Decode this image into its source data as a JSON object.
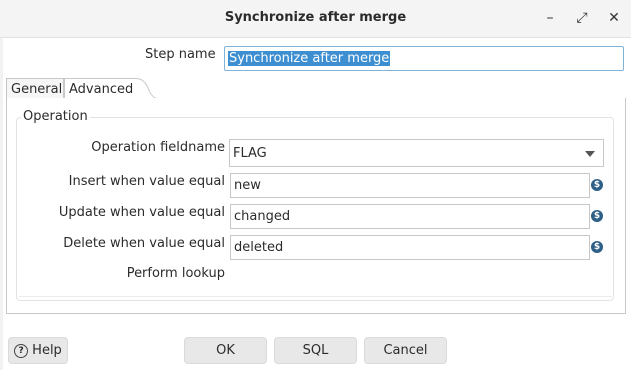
{
  "window": {
    "title": "Synchronize after merge",
    "minimize_glyph": "–",
    "maximize_glyph": "⤢",
    "close_glyph": "✕"
  },
  "step": {
    "label": "Step name",
    "value": "Synchronize after merge"
  },
  "tabs": [
    {
      "label": "General",
      "active": false
    },
    {
      "label": "Advanced",
      "active": true
    }
  ],
  "operation": {
    "group_title": "Operation",
    "fieldname_label": "Operation fieldname",
    "fieldname_value": "FLAG",
    "insert_label": "Insert when value equal",
    "insert_value": "new",
    "update_label": "Update when value equal",
    "update_value": "changed",
    "delete_label": "Delete when value equal",
    "delete_value": "deleted",
    "perform_lookup_label": "Perform lookup",
    "variable_icon_glyph": "$"
  },
  "buttons": {
    "help": "Help",
    "ok": "OK",
    "sql": "SQL",
    "cancel": "Cancel"
  },
  "colors": {
    "accent": "#3d8fd1",
    "variable_icon": "#2e5f86"
  }
}
